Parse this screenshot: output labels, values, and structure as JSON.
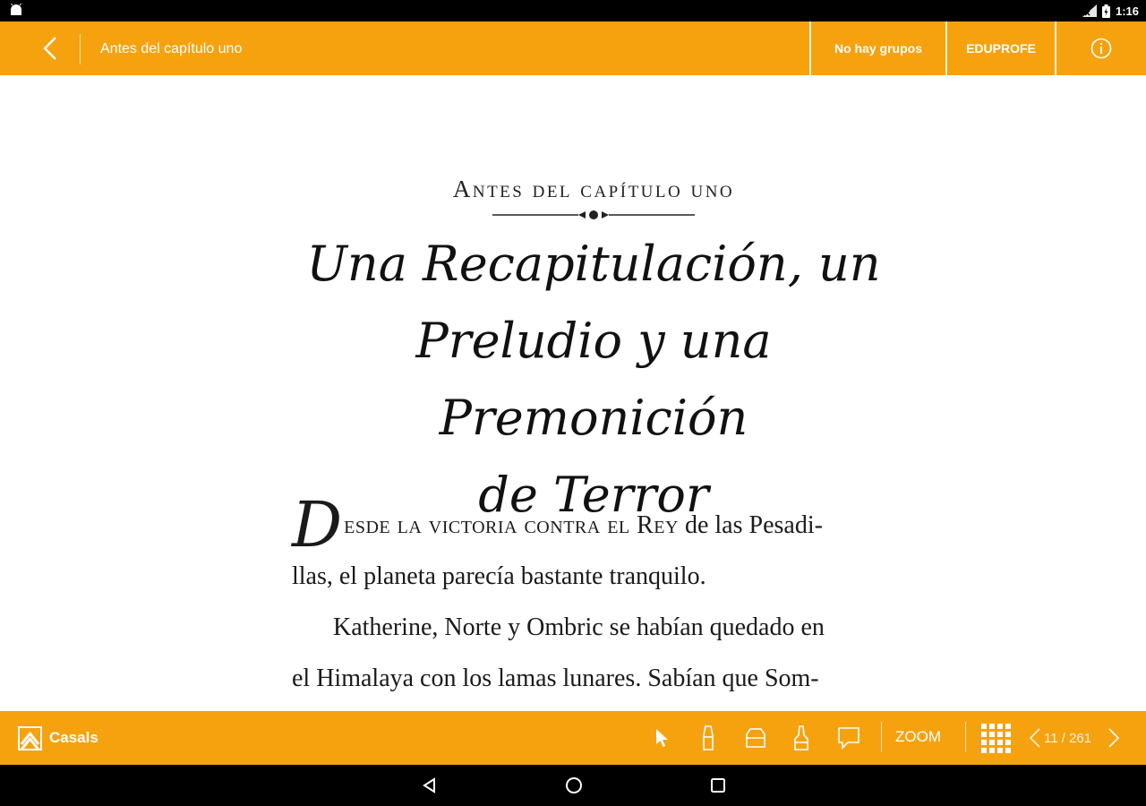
{
  "status_bar": {
    "time": "1:16",
    "icons": [
      "android-icon",
      "signal-icon",
      "battery-icon"
    ]
  },
  "top_bar": {
    "back_icon": "chevron-left-icon",
    "title": "Antes del capítulo uno",
    "groups_label": "No hay grupos",
    "user_label": "EDUPROFE",
    "info_icon": "info-icon",
    "color": "#f6a20f"
  },
  "page": {
    "eyebrow": "Antes del capítulo uno",
    "heading_lines": [
      "Una Recapitulación, un",
      "Preludio y una Premonición",
      "de Terror"
    ],
    "dropcap": "D",
    "first_smallcaps": "esde la victoria contra el Rey",
    "first_rest": " de las Pesadi-",
    "line2": "llas, el planeta parecía bastante tranquilo.",
    "line3": "Katherine, Norte y Ombric se habían quedado en",
    "line4": "el Himalaya con los lamas lunares. Sabían que Som-"
  },
  "bottom_bar": {
    "brand": "Casals",
    "tools": [
      "cursor-icon",
      "marker-icon",
      "eraser-icon",
      "highlighter-icon",
      "comment-icon"
    ],
    "zoom_label": "ZOOM",
    "grid_icon": "grid-icon",
    "page_current": 11,
    "page_total": 261,
    "pager_text": "11 / 261"
  },
  "nav_bar": {
    "buttons": [
      "nav-back-icon",
      "nav-home-icon",
      "nav-recents-icon"
    ]
  }
}
